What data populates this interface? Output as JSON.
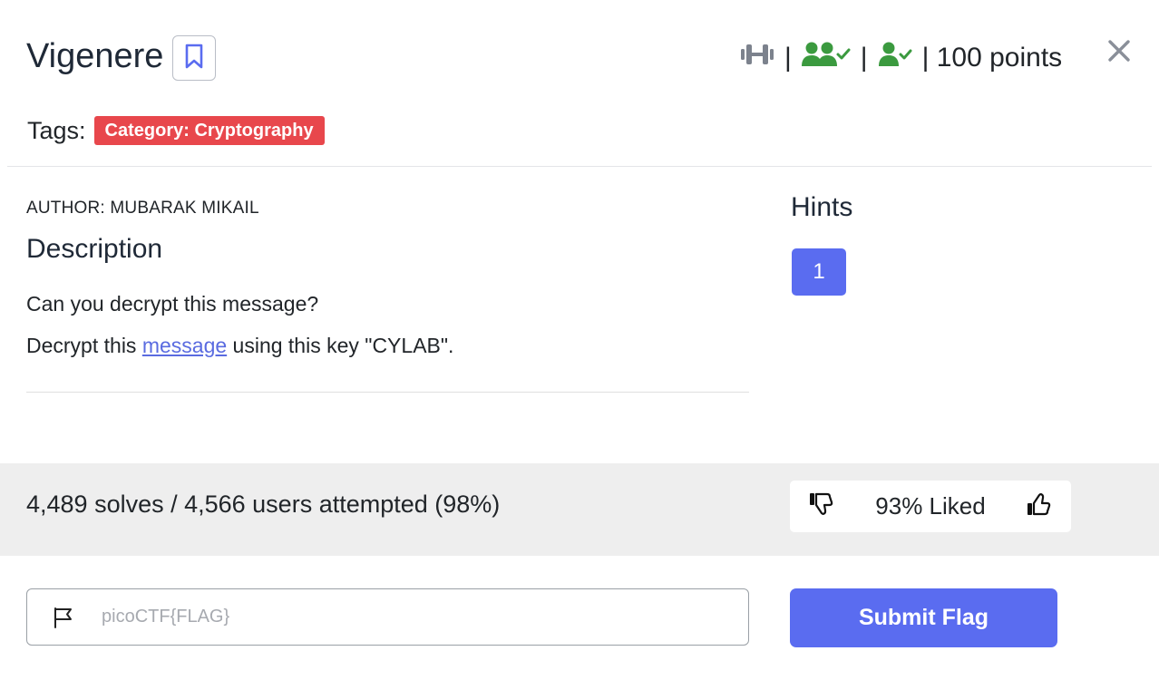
{
  "challenge": {
    "title": "Vigenere",
    "points": "| 100 points",
    "tags_label": "Tags:",
    "tag": "Category: Cryptography"
  },
  "author": "AUTHOR: MUBARAK MIKAIL",
  "description": {
    "heading": "Description",
    "line1": "Can you decrypt this message?",
    "line2_before": "Decrypt this ",
    "line2_link": "message",
    "line2_after": " using this key \"CYLAB\"."
  },
  "hints": {
    "heading": "Hints",
    "items": [
      "1"
    ]
  },
  "stats": {
    "solves_text": "4,489 solves / 4,566 users attempted (98%)",
    "liked_text": "93% Liked"
  },
  "flag": {
    "placeholder": "picoCTF{FLAG}",
    "value": "",
    "submit_label": "Submit Flag"
  },
  "icons": {
    "difficulty": "dumbbell-icon",
    "team_solved": "users-check-icon",
    "user_solved": "user-check-icon",
    "bookmark": "bookmark-icon",
    "close": "close-icon",
    "dislike": "thumbs-down-icon",
    "like": "thumbs-up-icon",
    "flag": "flag-icon"
  },
  "colors": {
    "accent": "#5a6cf0",
    "tag": "#e8474c",
    "solved_green": "#3b9a3f",
    "difficulty_gray": "#7c828d"
  },
  "meta_separator": "|"
}
